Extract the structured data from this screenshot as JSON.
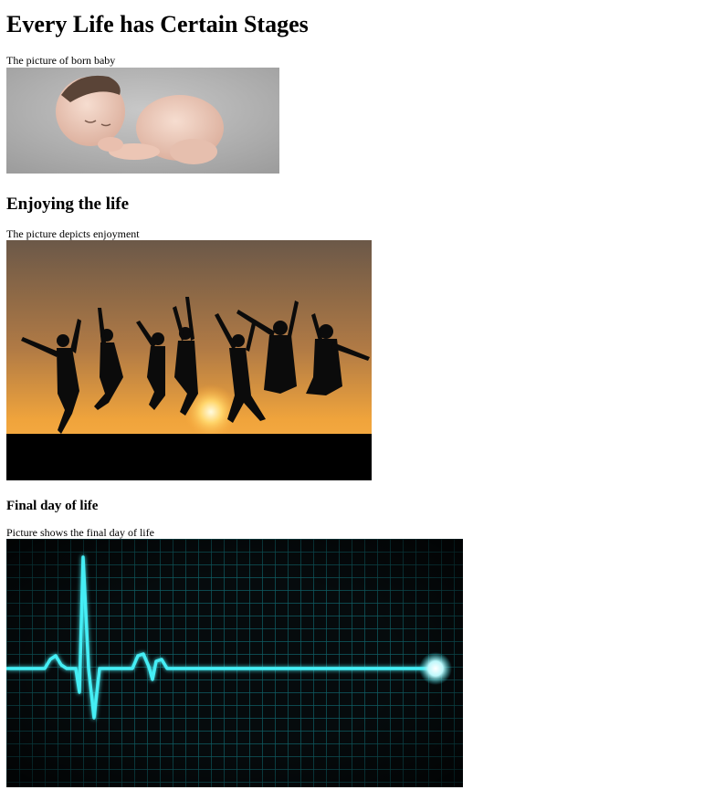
{
  "page": {
    "title": "Every Life has Certain Stages"
  },
  "sections": [
    {
      "caption": "The picture of born baby"
    },
    {
      "heading": "Enjoying the life",
      "caption": "The picture depicts enjoyment"
    },
    {
      "heading": "Final day of life",
      "caption": "Picture shows the final day of life"
    }
  ],
  "colors": {
    "baby_background": "#b7b7b7",
    "sunset_top": "#6e5a47",
    "sunset_glow": "#f7a93b",
    "ecg_line": "#2fe6ee",
    "ecg_grid": "#0e5a60",
    "ecg_background": "#060b0d"
  },
  "icons": {
    "baby_photo": "newborn-baby-image",
    "jumping_photo": "jumping-silhouettes-sunset-image",
    "ecg_photo": "heartbeat-monitor-flatline-image"
  }
}
